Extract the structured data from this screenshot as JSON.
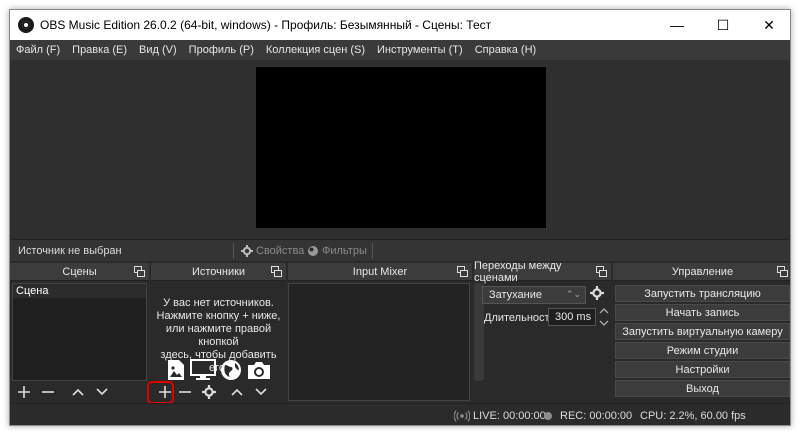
{
  "window": {
    "title": "OBS Music Edition 26.0.2 (64-bit, windows) - Профиль: Безымянный - Сцены: Тест",
    "controls": {
      "minimize": "—",
      "maximize": "☐",
      "close": "✕"
    }
  },
  "menu": {
    "items": [
      "Файл (F)",
      "Правка (E)",
      "Вид (V)",
      "Профиль (P)",
      "Коллекция сцен (S)",
      "Инструменты (T)",
      "Справка (H)"
    ]
  },
  "source_bar": {
    "no_selection": "Источник не выбран",
    "properties": "Свойства",
    "filters": "Фильтры"
  },
  "docks": {
    "scenes": {
      "title": "Сцены",
      "items": [
        "Сцена"
      ]
    },
    "sources": {
      "title": "Источники",
      "empty_line1": "У вас нет источников.",
      "empty_line2": "Нажмите кнопку + ниже,",
      "empty_line3": "или нажмите правой кнопкой",
      "empty_line4": "здесь, чтобы добавить его."
    },
    "mixer": {
      "title": "Input Mixer"
    },
    "transitions": {
      "title": "Переходы между сценами",
      "selected": "Затухание",
      "duration_label": "Длительность",
      "duration_value": "300 ms"
    },
    "controls": {
      "title": "Управление",
      "buttons": [
        "Запустить трансляцию",
        "Начать запись",
        "Запустить виртуальную камеру",
        "Режим студии",
        "Настройки",
        "Выход"
      ]
    }
  },
  "status": {
    "live": "LIVE: 00:00:00",
    "rec": "REC: 00:00:00",
    "cpu": "CPU: 2.2%, 60.00 fps"
  },
  "colors": {
    "bg": "#2b2b2b",
    "panel_header": "#3c3c3c",
    "highlight": "#e00000"
  }
}
